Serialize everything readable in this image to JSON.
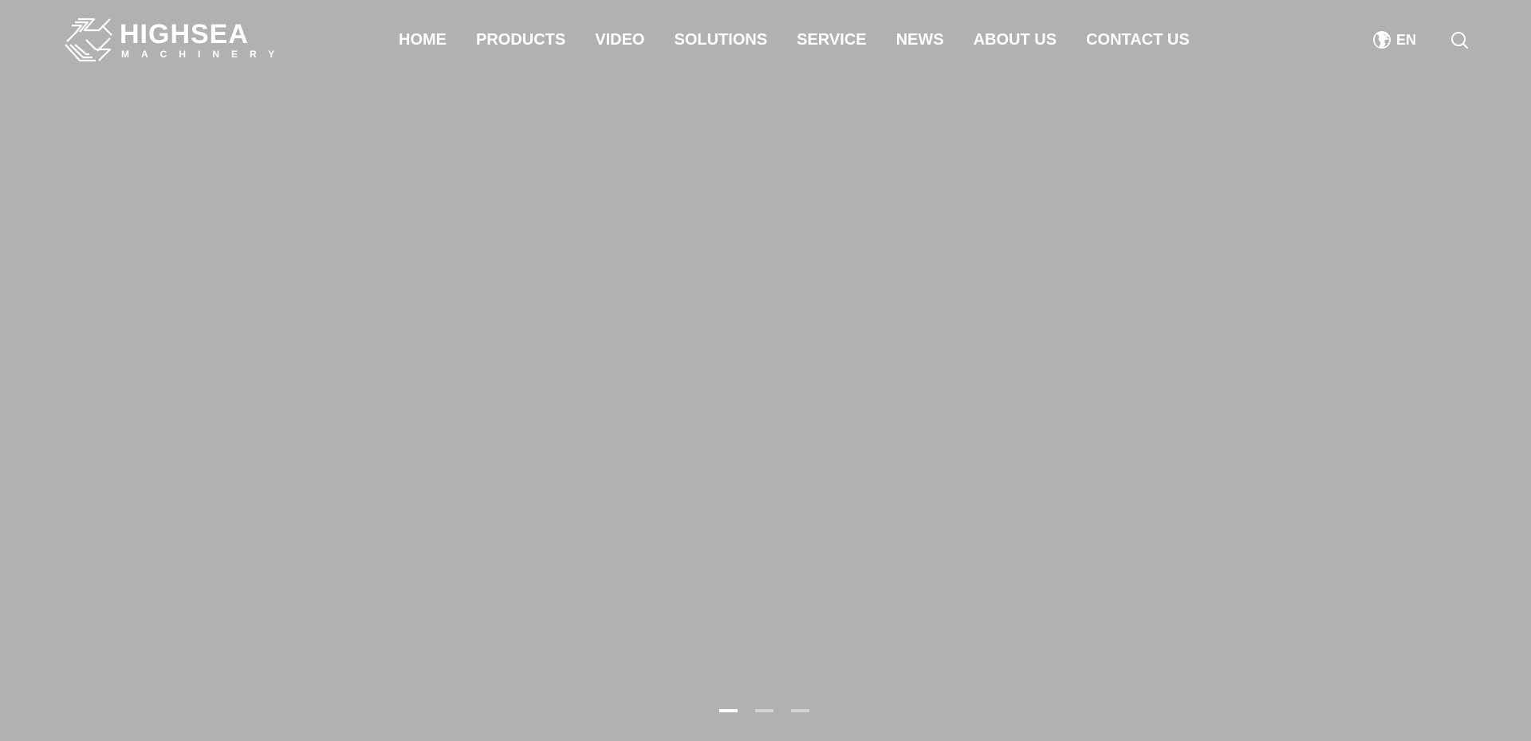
{
  "brand": {
    "name": "HIGHSEA",
    "tagline": "MACHINERY"
  },
  "nav": {
    "items": [
      {
        "label": "HOME"
      },
      {
        "label": "PRODUCTS"
      },
      {
        "label": "VIDEO"
      },
      {
        "label": "SOLUTIONS"
      },
      {
        "label": "SERVICE"
      },
      {
        "label": "NEWS"
      },
      {
        "label": "ABOUT US"
      },
      {
        "label": "CONTACT US"
      }
    ]
  },
  "language": {
    "icon": "globe-icon",
    "label": "EN"
  },
  "search": {
    "icon": "search-icon"
  },
  "slider": {
    "slide_count": 3,
    "active_index": 0
  },
  "colors": {
    "background": "#b1b1b1",
    "text": "#ffffff",
    "dot_active": "#ffffff",
    "dot_inactive": "#d2d2d2"
  }
}
